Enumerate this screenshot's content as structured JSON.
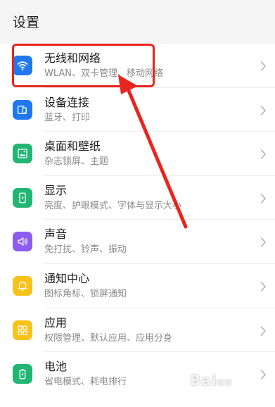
{
  "header": {
    "title": "设置"
  },
  "colors": {
    "wifi": "#1f78f0",
    "device": "#1f78f0",
    "wallpaper": "#22b573",
    "display": "#22b573",
    "sound": "#8c5cf0",
    "notify": "#f7c21a",
    "apps": "#f7c21a",
    "battery": "#22b573",
    "highlight": "#e8261f"
  },
  "settings": {
    "items": [
      {
        "label": "无线和网络",
        "sub": "WLAN、双卡管理、移动网络",
        "icon": "wifi-icon"
      },
      {
        "label": "设备连接",
        "sub": "蓝牙、打印",
        "icon": "device-connection-icon"
      },
      {
        "label": "桌面和壁纸",
        "sub": "杂志锁屏、主题",
        "icon": "wallpaper-icon"
      },
      {
        "label": "显示",
        "sub": "亮度、护眼模式、字体与显示大小",
        "icon": "display-icon"
      },
      {
        "label": "声音",
        "sub": "免打扰、铃声、振动",
        "icon": "speaker-icon"
      },
      {
        "label": "通知中心",
        "sub": "图标角标、锁屏通知",
        "icon": "bell-icon"
      },
      {
        "label": "应用",
        "sub": "权限管理、默认应用、应用分身",
        "icon": "apps-grid-icon"
      },
      {
        "label": "电池",
        "sub": "省电模式、耗电排行",
        "icon": "battery-icon"
      }
    ]
  },
  "watermark": {
    "text": "Bai",
    "suffix": "经验"
  }
}
